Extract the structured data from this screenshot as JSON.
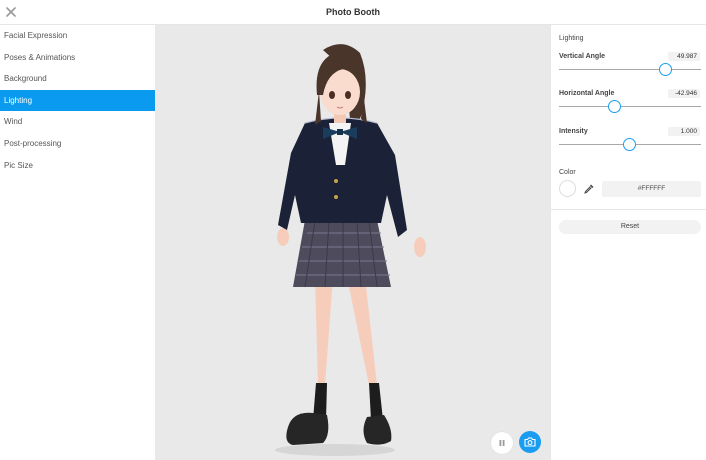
{
  "window": {
    "title": "Photo Booth",
    "close_icon": "close-icon"
  },
  "sidebar": {
    "items": [
      {
        "label": "Facial Expression",
        "active": false
      },
      {
        "label": "Poses & Animations",
        "active": false
      },
      {
        "label": "Background",
        "active": false
      },
      {
        "label": "Lighting",
        "active": true
      },
      {
        "label": "Wind",
        "active": false
      },
      {
        "label": "Post-processing",
        "active": false
      },
      {
        "label": "Pic Size",
        "active": false
      }
    ],
    "active_color": "#0A9BF0"
  },
  "viewport": {
    "controls": {
      "pause_icon": "pause-icon",
      "camera_icon": "camera-icon"
    },
    "background_color": "#E9E9E9"
  },
  "panel": {
    "heading": "Lighting",
    "vertical_angle": {
      "label": "Vertical Angle",
      "value": "49.987",
      "slider_fraction": 0.752
    },
    "horizontal_angle": {
      "label": "Horizontal Angle",
      "value": "-42.946",
      "slider_fraction": 0.395
    },
    "intensity": {
      "label": "Intensity",
      "value": "1.000",
      "slider_fraction": 0.5
    },
    "color": {
      "label": "Color",
      "hex": "#FFFFFF",
      "eyedropper_icon": "eyedropper-icon"
    },
    "reset_label": "Reset",
    "accent_color": "#1A9CF0"
  }
}
